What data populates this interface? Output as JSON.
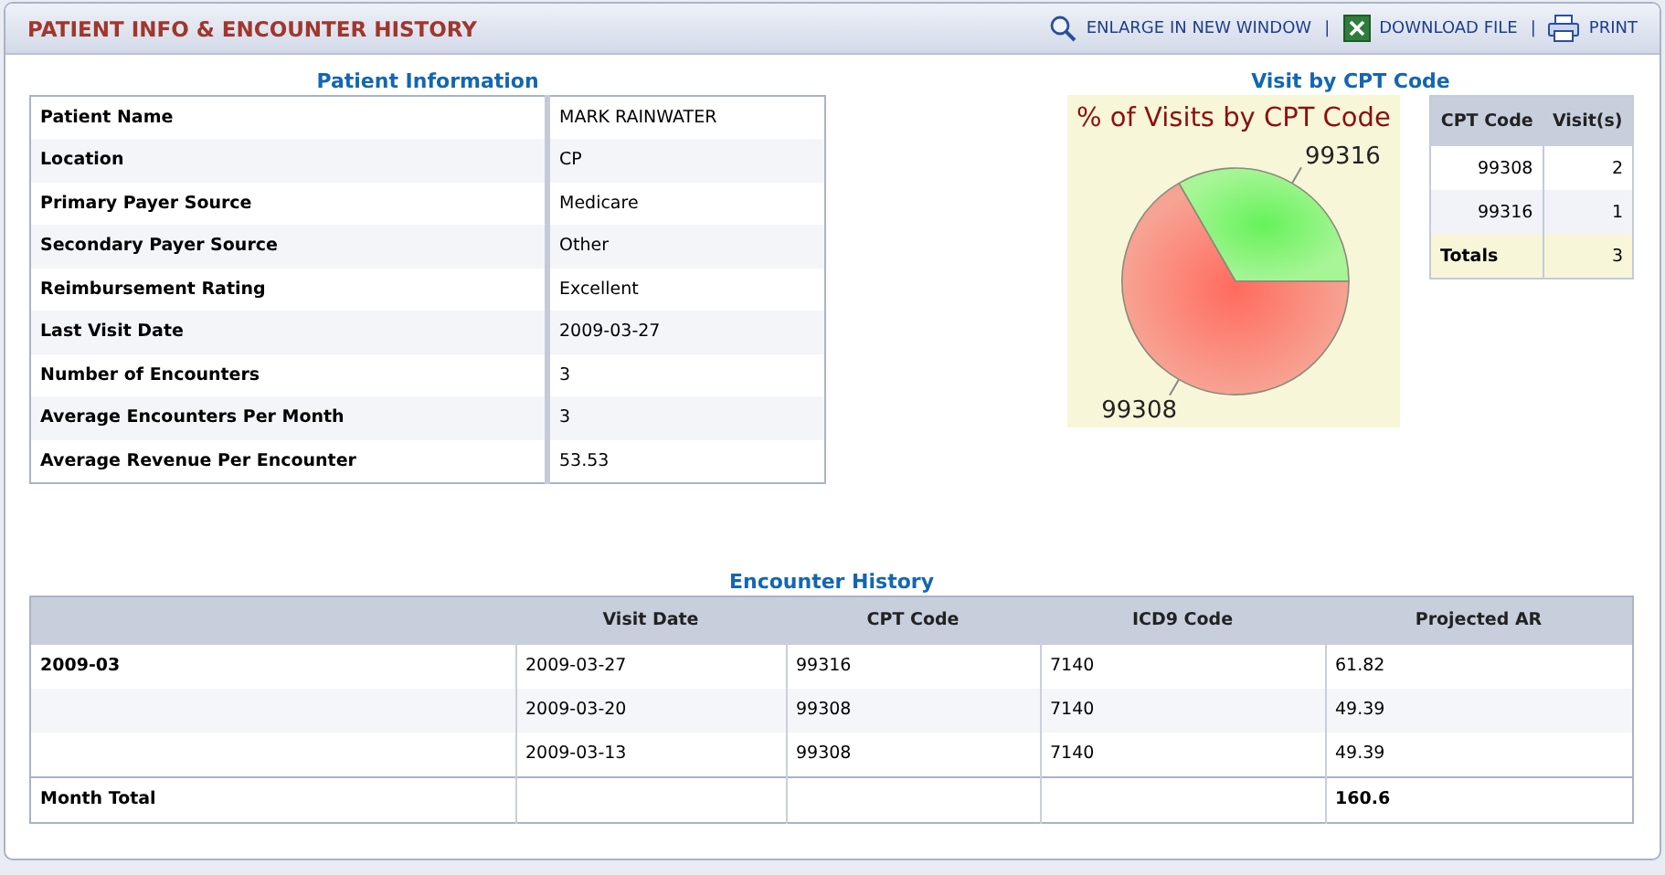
{
  "header": {
    "title": "PATIENT INFO & ENCOUNTER HISTORY",
    "actions": [
      {
        "label": "ENLARGE IN NEW WINDOW",
        "kind": "zoom"
      },
      {
        "label": "DOWNLOAD FILE",
        "kind": "excel"
      },
      {
        "label": "PRINT",
        "kind": "print"
      }
    ],
    "separator": "|"
  },
  "patient_info": {
    "title": "Patient Information",
    "rows": [
      {
        "label": "Patient Name",
        "value": "MARK RAINWATER"
      },
      {
        "label": "Location",
        "value": "CP"
      },
      {
        "label": "Primary Payer Source",
        "value": "Medicare"
      },
      {
        "label": "Secondary Payer Source",
        "value": "Other"
      },
      {
        "label": "Reimbursement Rating",
        "value": "Excellent"
      },
      {
        "label": "Last Visit Date",
        "value": "2009-03-27"
      },
      {
        "label": "Number of Encounters",
        "value": "3"
      },
      {
        "label": "Average Encounters Per Month",
        "value": "3"
      },
      {
        "label": "Average Revenue Per Encounter",
        "value": "53.53"
      }
    ]
  },
  "cpt_visits": {
    "title": "Visit by CPT Code",
    "chart_data": {
      "type": "pie",
      "title": "% of Visits by CPT Code",
      "categories": [
        "99308",
        "99316"
      ],
      "values": [
        66.67,
        33.33
      ]
    },
    "table": {
      "columns": [
        "CPT Code",
        "Visit(s)"
      ],
      "rows": [
        {
          "code": "99308",
          "visits": "2"
        },
        {
          "code": "99316",
          "visits": "1"
        }
      ],
      "totals": {
        "label": "Totals",
        "visits": "3"
      }
    }
  },
  "encounter_history": {
    "title": "Encounter History",
    "columns": [
      "Visit Date",
      "CPT Code",
      "ICD9 Code",
      "Projected AR"
    ],
    "groups": [
      {
        "month": "2009-03",
        "rows": [
          [
            "2009-03-27",
            "99316",
            "7140",
            "61.82"
          ],
          [
            "2009-03-20",
            "99308",
            "7140",
            "49.39"
          ],
          [
            "2009-03-13",
            "99308",
            "7140",
            "49.39"
          ]
        ]
      }
    ],
    "total": {
      "label": "Month Total",
      "projected_ar": "160.6"
    }
  }
}
